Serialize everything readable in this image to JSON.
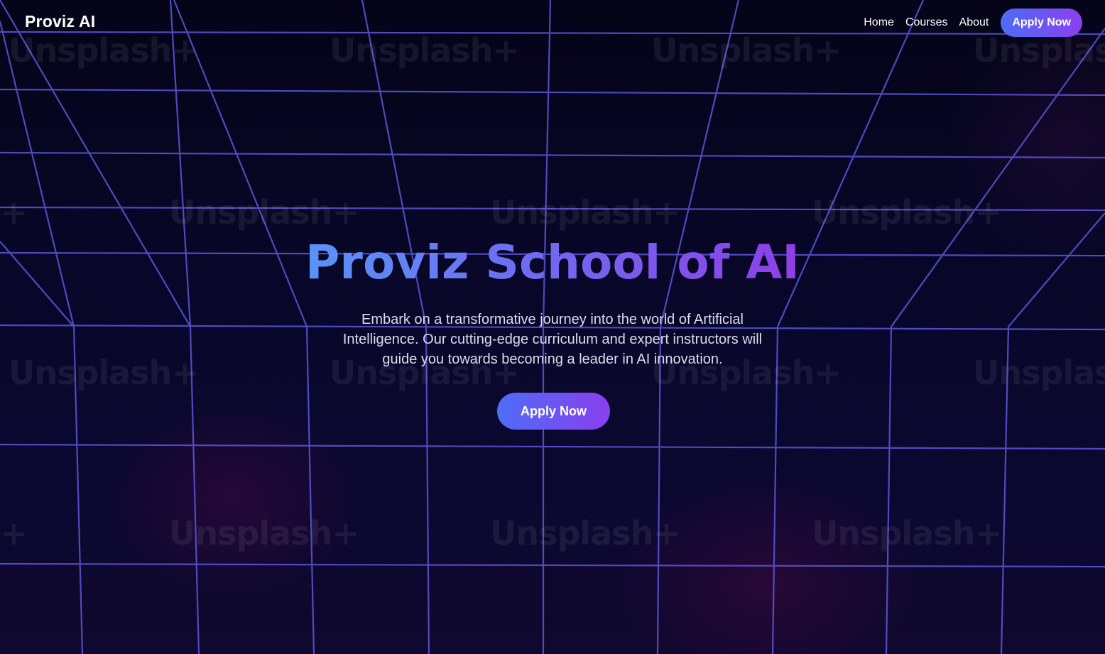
{
  "header": {
    "logo": "Proviz AI",
    "nav": {
      "home": "Home",
      "courses": "Courses",
      "about": "About",
      "apply": "Apply Now"
    }
  },
  "hero": {
    "title": "Proviz School of AI",
    "subtitle_lines": [
      "Embark on a transformative journey into the world of Artificial",
      "Intelligence. Our cutting-edge curriculum and expert instructors will",
      "guide you towards becoming a leader in AI innovation."
    ],
    "cta": "Apply Now"
  },
  "background": {
    "watermark_text": "Unsplash+",
    "watermark_fragment_left": "+",
    "watermark_fragment_right": "Unsplas"
  },
  "colors": {
    "background": "#07061c",
    "grid_line": "#5a58d8",
    "accent_start": "#4e6cf5",
    "accent_end": "#8b3ff0",
    "text": "#ffffff"
  }
}
